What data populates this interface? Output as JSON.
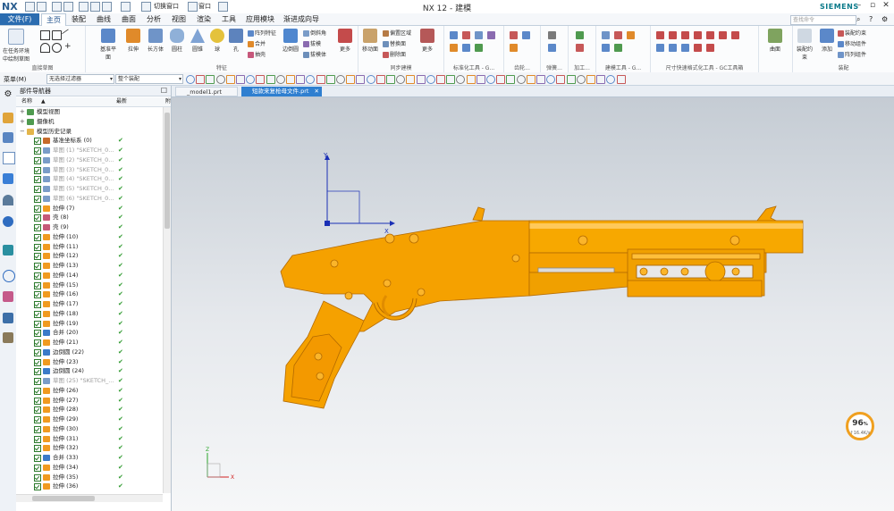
{
  "app": {
    "logo": "NX",
    "title": "NX 12 - 建模",
    "brand": "SIEMENS",
    "search_placeholder": "查找命令",
    "quick_access": [
      "切换窗口",
      "窗口"
    ]
  },
  "menu": {
    "file": "文件(F)",
    "items": [
      "主页",
      "装配",
      "曲线",
      "曲面",
      "分析",
      "视图",
      "渲染",
      "工具",
      "应用模块",
      "渐进成向导"
    ]
  },
  "ribbon": {
    "groups": [
      {
        "label": "直接草图",
        "buttons": [
          "在任务环境中绘制草图"
        ]
      },
      {
        "label": "特征",
        "buttons": [
          "基准平面",
          "拉伸",
          "长方体",
          "圆柱",
          "圆锥",
          "球",
          "孔",
          "阵列特征",
          "合并",
          "抽壳",
          "边倒圆",
          "倒斜角",
          "拔模",
          "拔模体",
          "更多"
        ]
      },
      {
        "label": "同步建模",
        "buttons": [
          "移动面",
          "偏置区域",
          "替换面",
          "删除面",
          "更多"
        ]
      },
      {
        "label": "标准化工具 - G...",
        "buttons": []
      },
      {
        "label": "齿轮...",
        "buttons": []
      },
      {
        "label": "弹簧...",
        "buttons": []
      },
      {
        "label": "加工...",
        "buttons": []
      },
      {
        "label": "建模工具 - G...",
        "buttons": []
      },
      {
        "label": "尺寸快速格式化工具 - GC工具箱",
        "buttons": []
      },
      {
        "label": "曲面",
        "buttons": [
          "曲面"
        ]
      },
      {
        "label": "装配",
        "buttons": [
          "装配约束",
          "添加",
          "移动组件",
          "阵列组件"
        ]
      }
    ]
  },
  "toolbar2": {
    "menu_label": "菜单(M)",
    "filter": "无选择过滤器",
    "scope": "整个装配"
  },
  "navigator": {
    "title": "部件导航器",
    "col_name": "名称",
    "col_latest": "最新",
    "col_extra": "附",
    "tree": [
      {
        "label": "模型视图",
        "level": 0,
        "kind": "view",
        "check": false,
        "dim": false
      },
      {
        "label": "摄像机",
        "level": 0,
        "kind": "camera",
        "check": false,
        "dim": false
      },
      {
        "label": "模型历史记录",
        "level": 0,
        "kind": "folder",
        "check": false,
        "dim": false
      },
      {
        "label": "基准坐标系 (0)",
        "level": 1,
        "kind": "datum",
        "check": true,
        "dim": false
      },
      {
        "label": "草图 (1) \"SKETCH_0...",
        "level": 1,
        "kind": "sketch",
        "check": true,
        "dim": true
      },
      {
        "label": "草图 (2) \"SKETCH_0...",
        "level": 1,
        "kind": "sketch",
        "check": true,
        "dim": true
      },
      {
        "label": "草图 (3) \"SKETCH_0...",
        "level": 1,
        "kind": "sketch",
        "check": true,
        "dim": true
      },
      {
        "label": "草图 (4) \"SKETCH_0...",
        "level": 1,
        "kind": "sketch",
        "check": true,
        "dim": true
      },
      {
        "label": "草图 (5) \"SKETCH_0...",
        "level": 1,
        "kind": "sketch",
        "check": true,
        "dim": true
      },
      {
        "label": "草图 (6) \"SKETCH_0...",
        "level": 1,
        "kind": "sketch",
        "check": true,
        "dim": true
      },
      {
        "label": "拉伸 (7)",
        "level": 1,
        "kind": "extrude",
        "check": true,
        "dim": false
      },
      {
        "label": "壳 (8)",
        "level": 1,
        "kind": "shell",
        "check": true,
        "dim": false
      },
      {
        "label": "壳 (9)",
        "level": 1,
        "kind": "shell",
        "check": true,
        "dim": false
      },
      {
        "label": "拉伸 (10)",
        "level": 1,
        "kind": "extrude",
        "check": true,
        "dim": false
      },
      {
        "label": "拉伸 (11)",
        "level": 1,
        "kind": "extrude",
        "check": true,
        "dim": false
      },
      {
        "label": "拉伸 (12)",
        "level": 1,
        "kind": "extrude",
        "check": true,
        "dim": false
      },
      {
        "label": "拉伸 (13)",
        "level": 1,
        "kind": "extrude",
        "check": true,
        "dim": false
      },
      {
        "label": "拉伸 (14)",
        "level": 1,
        "kind": "extrude",
        "check": true,
        "dim": false
      },
      {
        "label": "拉伸 (15)",
        "level": 1,
        "kind": "extrude",
        "check": true,
        "dim": false
      },
      {
        "label": "拉伸 (16)",
        "level": 1,
        "kind": "extrude",
        "check": true,
        "dim": false
      },
      {
        "label": "拉伸 (17)",
        "level": 1,
        "kind": "extrude",
        "check": true,
        "dim": false
      },
      {
        "label": "拉伸 (18)",
        "level": 1,
        "kind": "extrude",
        "check": true,
        "dim": false
      },
      {
        "label": "拉伸 (19)",
        "level": 1,
        "kind": "extrude",
        "check": true,
        "dim": false
      },
      {
        "label": "合并 (20)",
        "level": 1,
        "kind": "unite",
        "check": true,
        "dim": false
      },
      {
        "label": "拉伸 (21)",
        "level": 1,
        "kind": "extrude",
        "check": true,
        "dim": false
      },
      {
        "label": "边倒圆 (22)",
        "level": 1,
        "kind": "blend",
        "check": true,
        "dim": false
      },
      {
        "label": "拉伸 (23)",
        "level": 1,
        "kind": "extrude",
        "check": true,
        "dim": false
      },
      {
        "label": "边倒圆 (24)",
        "level": 1,
        "kind": "blend",
        "check": true,
        "dim": false
      },
      {
        "label": "草图 (25) \"SKETCH_...",
        "level": 1,
        "kind": "sketch",
        "check": true,
        "dim": true
      },
      {
        "label": "拉伸 (26)",
        "level": 1,
        "kind": "extrude",
        "check": true,
        "dim": false
      },
      {
        "label": "拉伸 (27)",
        "level": 1,
        "kind": "extrude",
        "check": true,
        "dim": false
      },
      {
        "label": "拉伸 (28)",
        "level": 1,
        "kind": "extrude",
        "check": true,
        "dim": false
      },
      {
        "label": "拉伸 (29)",
        "level": 1,
        "kind": "extrude",
        "check": true,
        "dim": false
      },
      {
        "label": "拉伸 (30)",
        "level": 1,
        "kind": "extrude",
        "check": true,
        "dim": false
      },
      {
        "label": "拉伸 (31)",
        "level": 1,
        "kind": "extrude",
        "check": true,
        "dim": false
      },
      {
        "label": "拉伸 (32)",
        "level": 1,
        "kind": "extrude",
        "check": true,
        "dim": false
      },
      {
        "label": "合并 (33)",
        "level": 1,
        "kind": "unite",
        "check": true,
        "dim": false
      },
      {
        "label": "拉伸 (34)",
        "level": 1,
        "kind": "extrude",
        "check": true,
        "dim": false
      },
      {
        "label": "拉伸 (35)",
        "level": 1,
        "kind": "extrude",
        "check": true,
        "dim": false
      },
      {
        "label": "拉伸 (36)",
        "level": 1,
        "kind": "extrude",
        "check": true,
        "dim": false
      }
    ]
  },
  "tabs": [
    {
      "label": "_model1.prt",
      "active": false
    },
    {
      "label": "短款来复枪母文件.prt",
      "active": true
    }
  ],
  "viewport": {
    "axis_labels": {
      "y": "Y",
      "x": "X",
      "z": "Z"
    },
    "model_color": "#f5a100"
  },
  "status_badge": {
    "percent": "96",
    "percent_sign": "%",
    "speed": "↑16.4K/s"
  },
  "colors": {
    "accent": "#2b6cb0",
    "check": "#2f9a2f",
    "badge_ring": "#f0a020"
  }
}
